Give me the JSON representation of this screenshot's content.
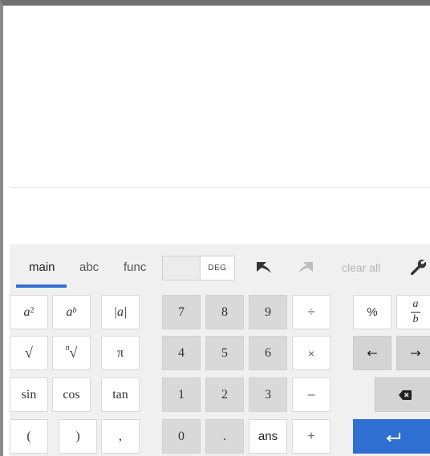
{
  "tabs": [
    {
      "label": "main",
      "active": true
    },
    {
      "label": "abc",
      "active": false
    },
    {
      "label": "func",
      "active": false
    }
  ],
  "angle_toggle": {
    "label": "DEG"
  },
  "toolbar": {
    "clear_all": "clear all"
  },
  "icons": {
    "undo": "undo-arrow-icon",
    "redo": "redo-arrow-icon",
    "settings": "wrench-icon",
    "backspace": "backspace-icon",
    "enter": "enter-icon",
    "left": "left-arrow-icon",
    "right": "right-arrow-icon"
  },
  "keys": {
    "a_squared": {
      "base": "a",
      "sup": "2"
    },
    "a_power_b": {
      "base": "a",
      "sup": "b"
    },
    "abs": "|a|",
    "sqrt": "√",
    "nth_root": {
      "index": "n",
      "root": "√"
    },
    "pi": "π",
    "sin": "sin",
    "cos": "cos",
    "tan": "tan",
    "lparen": "(",
    "rparen": ")",
    "comma": ",",
    "d7": "7",
    "d8": "8",
    "d9": "9",
    "d4": "4",
    "d5": "5",
    "d6": "6",
    "d1": "1",
    "d2": "2",
    "d3": "3",
    "d0": "0",
    "dot": ".",
    "ans": "ans",
    "divide": "÷",
    "multiply": "×",
    "minus": "–",
    "plus": "+",
    "percent": "%",
    "fraction": {
      "num": "a",
      "den": "b"
    },
    "left_arrow": "←",
    "right_arrow": "→"
  },
  "colors": {
    "accent": "#2f6fd2"
  }
}
